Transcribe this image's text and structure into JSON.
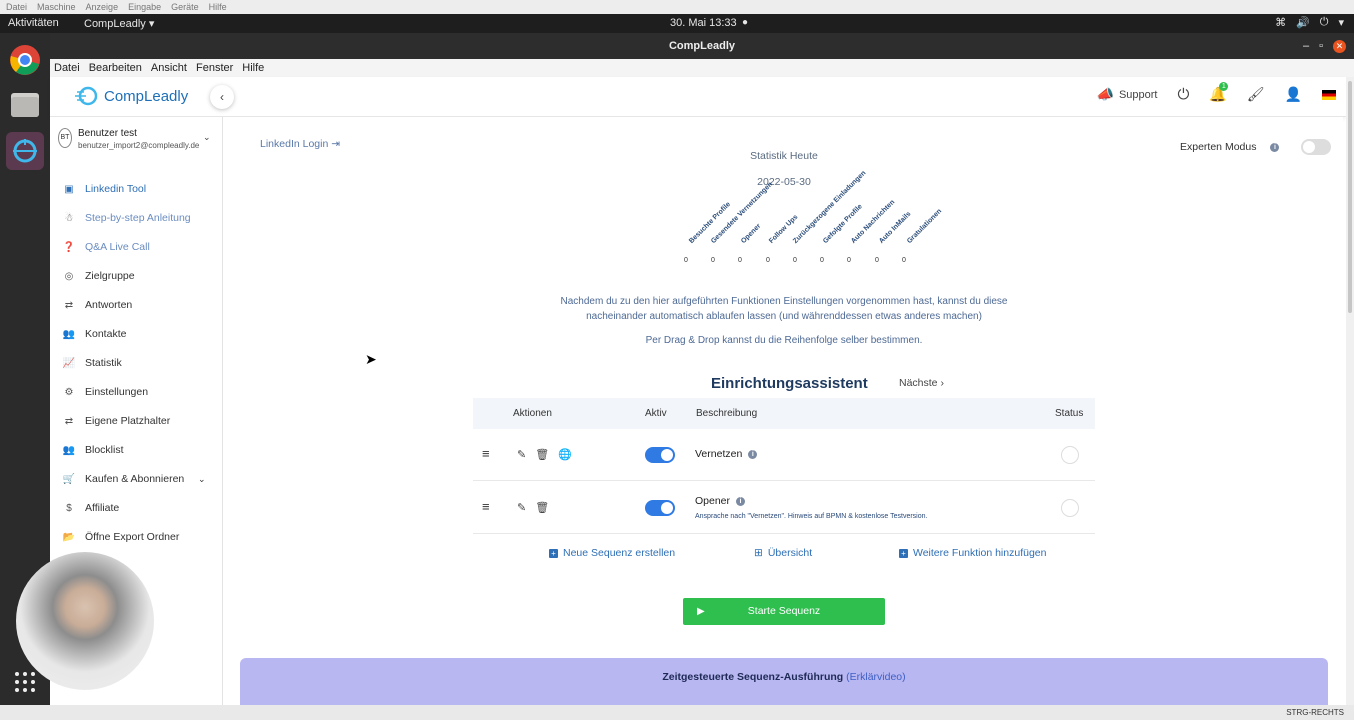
{
  "host_menu": [
    "Datei",
    "Maschine",
    "Anzeige",
    "Eingabe",
    "Geräte",
    "Hilfe"
  ],
  "topbar": {
    "activities": "Aktivitäten",
    "app": "CompLeadly ▾",
    "clock": "30. Mai  13:33"
  },
  "window": {
    "title": "CompLeadly"
  },
  "menubar": [
    "Datei",
    "Bearbeiten",
    "Ansicht",
    "Fenster",
    "Hilfe"
  ],
  "header": {
    "logo": "CompLeadly",
    "support": "Support",
    "notifications": "1"
  },
  "user": {
    "initials": "BT",
    "name": "Benutzer test",
    "email": "benutzer_import2@compleadly.de"
  },
  "nav": [
    {
      "label": "Linkedin Tool",
      "icon": "linkedin-icon"
    },
    {
      "label": "Step-by-step Anleitung",
      "icon": "person-icon"
    },
    {
      "label": "Q&A Live Call",
      "icon": "question-icon"
    },
    {
      "label": "Zielgruppe",
      "icon": "target-icon"
    },
    {
      "label": "Antworten",
      "icon": "replies-icon"
    },
    {
      "label": "Kontakte",
      "icon": "contacts-icon"
    },
    {
      "label": "Statistik",
      "icon": "chart-icon"
    },
    {
      "label": "Einstellungen",
      "icon": "gear-icon"
    },
    {
      "label": "Eigene Platzhalter",
      "icon": "placeholder-icon"
    },
    {
      "label": "Blocklist",
      "icon": "block-icon"
    },
    {
      "label": "Kaufen & Abonnieren",
      "icon": "cart-icon"
    },
    {
      "label": "Affiliate",
      "icon": "dollar-icon"
    },
    {
      "label": "Öffne Export Ordner",
      "icon": "folder-icon"
    }
  ],
  "content": {
    "linkedin_login": "LinkedIn Login",
    "expert_mode": "Experten Modus",
    "stat_title": "Statistik Heute",
    "stat_date": "2022-05-30",
    "stats": [
      {
        "label": "Besuchte Profile",
        "value": "0"
      },
      {
        "label": "Gesendete Vernetzungen",
        "value": "0"
      },
      {
        "label": "Opener",
        "value": "0"
      },
      {
        "label": "Follow Ups",
        "value": "0"
      },
      {
        "label": "Zurückgezogene Einladungen",
        "value": "0"
      },
      {
        "label": "Gefolgte Profile",
        "value": "0"
      },
      {
        "label": "Auto Nachrichten",
        "value": "0"
      },
      {
        "label": "Auto InMails",
        "value": "0"
      },
      {
        "label": "Gratulationen",
        "value": "0"
      }
    ],
    "info1": "Nachdem du zu den hier aufgeführten Funktionen Einstellungen vorgenommen hast, kannst du diese nacheinander automatisch ablaufen lassen (und währenddessen etwas anderes machen)",
    "info2": "Per Drag & Drop kannst du die Reihenfolge selber bestimmen.",
    "wizard_title": "Einrichtungsassistent",
    "wizard_next": "Nächste",
    "columns": {
      "actions": "Aktionen",
      "active": "Aktiv",
      "description": "Beschreibung",
      "status": "Status"
    },
    "rows": [
      {
        "title": "Vernetzen",
        "sub": ""
      },
      {
        "title": "Opener",
        "sub": "Ansprache nach \"Vernetzen\". Hinweis auf BPMN & kostenlose Testversion."
      }
    ],
    "new_sequence": "Neue Sequenz erstellen",
    "overview": "Übersicht",
    "add_function": "Weitere Funktion hinzufügen",
    "start": "Starte Sequenz",
    "banner": "Zeitgesteuerte Sequenz-Ausführung",
    "banner_link": "(Erklärvideo)"
  },
  "statusbar": "STRG-RECHTS"
}
